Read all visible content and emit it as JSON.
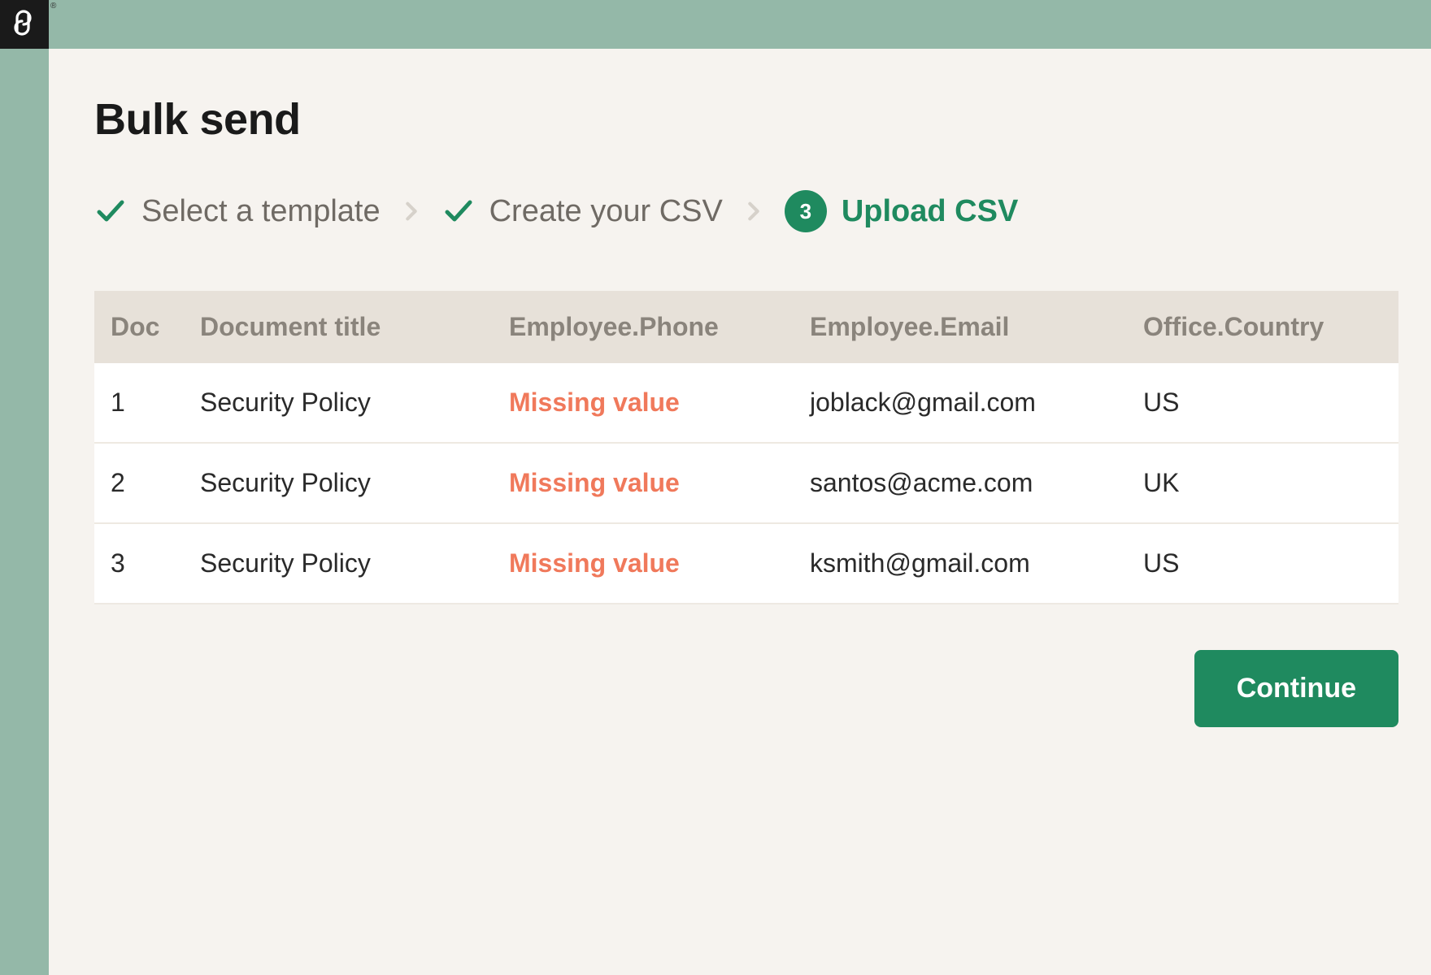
{
  "page": {
    "title": "Bulk send"
  },
  "steps": {
    "items": [
      {
        "label": "Select a template",
        "state": "done"
      },
      {
        "label": "Create your CSV",
        "state": "done"
      },
      {
        "label": "Upload CSV",
        "state": "active",
        "number": "3"
      }
    ]
  },
  "table": {
    "headers": {
      "doc": "Doc",
      "title": "Document title",
      "phone": "Employee.Phone",
      "email": "Employee.Email",
      "country": "Office.Country"
    },
    "missing_text": "Missing value",
    "rows": [
      {
        "doc": "1",
        "title": "Security Policy",
        "phone_missing": true,
        "email": "joblack@gmail.com",
        "country": "US"
      },
      {
        "doc": "2",
        "title": "Security Policy",
        "phone_missing": true,
        "email": "santos@acme.com",
        "country": "UK"
      },
      {
        "doc": "3",
        "title": "Security Policy",
        "phone_missing": true,
        "email": "ksmith@gmail.com",
        "country": "US"
      }
    ]
  },
  "footer": {
    "continue_label": "Continue"
  },
  "colors": {
    "accent": "#1f8a5f",
    "frame": "#94b8a8",
    "panel": "#f6f3ef",
    "header_row": "#e7e1d9",
    "missing": "#f0795b"
  }
}
